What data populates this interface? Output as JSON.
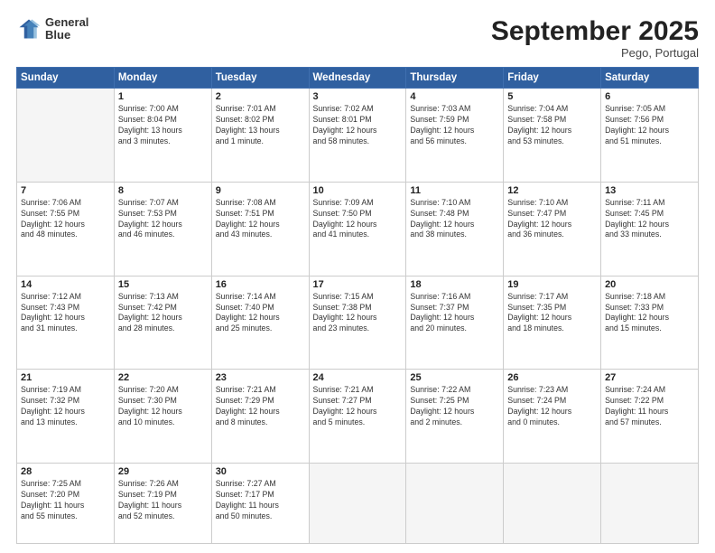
{
  "header": {
    "logo_line1": "General",
    "logo_line2": "Blue",
    "title": "September 2025",
    "subtitle": "Pego, Portugal"
  },
  "days_of_week": [
    "Sunday",
    "Monday",
    "Tuesday",
    "Wednesday",
    "Thursday",
    "Friday",
    "Saturday"
  ],
  "weeks": [
    [
      {
        "day": "",
        "info": ""
      },
      {
        "day": "1",
        "info": "Sunrise: 7:00 AM\nSunset: 8:04 PM\nDaylight: 13 hours\nand 3 minutes."
      },
      {
        "day": "2",
        "info": "Sunrise: 7:01 AM\nSunset: 8:02 PM\nDaylight: 13 hours\nand 1 minute."
      },
      {
        "day": "3",
        "info": "Sunrise: 7:02 AM\nSunset: 8:01 PM\nDaylight: 12 hours\nand 58 minutes."
      },
      {
        "day": "4",
        "info": "Sunrise: 7:03 AM\nSunset: 7:59 PM\nDaylight: 12 hours\nand 56 minutes."
      },
      {
        "day": "5",
        "info": "Sunrise: 7:04 AM\nSunset: 7:58 PM\nDaylight: 12 hours\nand 53 minutes."
      },
      {
        "day": "6",
        "info": "Sunrise: 7:05 AM\nSunset: 7:56 PM\nDaylight: 12 hours\nand 51 minutes."
      }
    ],
    [
      {
        "day": "7",
        "info": "Sunrise: 7:06 AM\nSunset: 7:55 PM\nDaylight: 12 hours\nand 48 minutes."
      },
      {
        "day": "8",
        "info": "Sunrise: 7:07 AM\nSunset: 7:53 PM\nDaylight: 12 hours\nand 46 minutes."
      },
      {
        "day": "9",
        "info": "Sunrise: 7:08 AM\nSunset: 7:51 PM\nDaylight: 12 hours\nand 43 minutes."
      },
      {
        "day": "10",
        "info": "Sunrise: 7:09 AM\nSunset: 7:50 PM\nDaylight: 12 hours\nand 41 minutes."
      },
      {
        "day": "11",
        "info": "Sunrise: 7:10 AM\nSunset: 7:48 PM\nDaylight: 12 hours\nand 38 minutes."
      },
      {
        "day": "12",
        "info": "Sunrise: 7:10 AM\nSunset: 7:47 PM\nDaylight: 12 hours\nand 36 minutes."
      },
      {
        "day": "13",
        "info": "Sunrise: 7:11 AM\nSunset: 7:45 PM\nDaylight: 12 hours\nand 33 minutes."
      }
    ],
    [
      {
        "day": "14",
        "info": "Sunrise: 7:12 AM\nSunset: 7:43 PM\nDaylight: 12 hours\nand 31 minutes."
      },
      {
        "day": "15",
        "info": "Sunrise: 7:13 AM\nSunset: 7:42 PM\nDaylight: 12 hours\nand 28 minutes."
      },
      {
        "day": "16",
        "info": "Sunrise: 7:14 AM\nSunset: 7:40 PM\nDaylight: 12 hours\nand 25 minutes."
      },
      {
        "day": "17",
        "info": "Sunrise: 7:15 AM\nSunset: 7:38 PM\nDaylight: 12 hours\nand 23 minutes."
      },
      {
        "day": "18",
        "info": "Sunrise: 7:16 AM\nSunset: 7:37 PM\nDaylight: 12 hours\nand 20 minutes."
      },
      {
        "day": "19",
        "info": "Sunrise: 7:17 AM\nSunset: 7:35 PM\nDaylight: 12 hours\nand 18 minutes."
      },
      {
        "day": "20",
        "info": "Sunrise: 7:18 AM\nSunset: 7:33 PM\nDaylight: 12 hours\nand 15 minutes."
      }
    ],
    [
      {
        "day": "21",
        "info": "Sunrise: 7:19 AM\nSunset: 7:32 PM\nDaylight: 12 hours\nand 13 minutes."
      },
      {
        "day": "22",
        "info": "Sunrise: 7:20 AM\nSunset: 7:30 PM\nDaylight: 12 hours\nand 10 minutes."
      },
      {
        "day": "23",
        "info": "Sunrise: 7:21 AM\nSunset: 7:29 PM\nDaylight: 12 hours\nand 8 minutes."
      },
      {
        "day": "24",
        "info": "Sunrise: 7:21 AM\nSunset: 7:27 PM\nDaylight: 12 hours\nand 5 minutes."
      },
      {
        "day": "25",
        "info": "Sunrise: 7:22 AM\nSunset: 7:25 PM\nDaylight: 12 hours\nand 2 minutes."
      },
      {
        "day": "26",
        "info": "Sunrise: 7:23 AM\nSunset: 7:24 PM\nDaylight: 12 hours\nand 0 minutes."
      },
      {
        "day": "27",
        "info": "Sunrise: 7:24 AM\nSunset: 7:22 PM\nDaylight: 11 hours\nand 57 minutes."
      }
    ],
    [
      {
        "day": "28",
        "info": "Sunrise: 7:25 AM\nSunset: 7:20 PM\nDaylight: 11 hours\nand 55 minutes."
      },
      {
        "day": "29",
        "info": "Sunrise: 7:26 AM\nSunset: 7:19 PM\nDaylight: 11 hours\nand 52 minutes."
      },
      {
        "day": "30",
        "info": "Sunrise: 7:27 AM\nSunset: 7:17 PM\nDaylight: 11 hours\nand 50 minutes."
      },
      {
        "day": "",
        "info": ""
      },
      {
        "day": "",
        "info": ""
      },
      {
        "day": "",
        "info": ""
      },
      {
        "day": "",
        "info": ""
      }
    ]
  ]
}
